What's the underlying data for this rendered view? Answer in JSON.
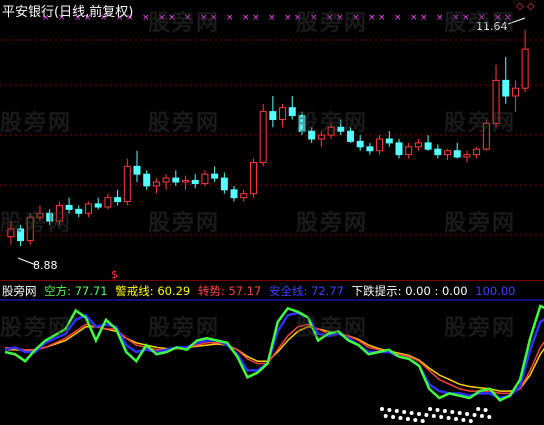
{
  "chart": {
    "title": "平安银行(日线,前复权)",
    "price_high_label": "11.64",
    "price_low_label": "8.88",
    "high_marker": "◇ ◇",
    "watermark": "股旁网",
    "colors": {
      "background": "#000000",
      "up_candle": "#ff3b3b",
      "down_candle": "#54ffff",
      "grid": "#8b0000",
      "x_marks": "#ff40ff"
    }
  },
  "indicator": {
    "name": "股旁网",
    "kongfang": {
      "label": "空方:",
      "value": "77.71",
      "color": "#54ff54"
    },
    "jingjie": {
      "label": "警戒线:",
      "value": "60.29",
      "color": "#ffff00"
    },
    "zhuanshi": {
      "label": "转势:",
      "value": "57.17",
      "color": "#ff4040"
    },
    "anquan": {
      "label": "安全线:",
      "value": "72.77",
      "color": "#4040ff"
    },
    "xiadie": {
      "label": "下跌提示:",
      "value": "0.00 : 0.00",
      "color": "#ffffff"
    },
    "last_value": {
      "value": "100.00",
      "color": "#4040ff"
    },
    "signal_icon": "$"
  },
  "chart_data": {
    "type": "candlestick",
    "price_range": [
      8.88,
      11.64
    ],
    "candles": [
      [
        9.0,
        9.2,
        8.9,
        9.1
      ],
      [
        9.1,
        9.15,
        8.88,
        8.95
      ],
      [
        8.95,
        9.3,
        8.9,
        9.25
      ],
      [
        9.25,
        9.4,
        9.2,
        9.3
      ],
      [
        9.3,
        9.35,
        9.15,
        9.2
      ],
      [
        9.2,
        9.45,
        9.15,
        9.4
      ],
      [
        9.4,
        9.5,
        9.3,
        9.35
      ],
      [
        9.35,
        9.4,
        9.25,
        9.3
      ],
      [
        9.3,
        9.45,
        9.25,
        9.42
      ],
      [
        9.42,
        9.5,
        9.35,
        9.38
      ],
      [
        9.38,
        9.55,
        9.35,
        9.5
      ],
      [
        9.5,
        9.6,
        9.4,
        9.45
      ],
      [
        9.45,
        10.0,
        9.4,
        9.9
      ],
      [
        9.9,
        10.1,
        9.7,
        9.8
      ],
      [
        9.8,
        9.85,
        9.6,
        9.65
      ],
      [
        9.65,
        9.75,
        9.55,
        9.7
      ],
      [
        9.7,
        9.8,
        9.6,
        9.75
      ],
      [
        9.75,
        9.85,
        9.65,
        9.7
      ],
      [
        9.7,
        9.78,
        9.6,
        9.72
      ],
      [
        9.72,
        9.8,
        9.62,
        9.68
      ],
      [
        9.68,
        9.85,
        9.65,
        9.8
      ],
      [
        9.8,
        9.9,
        9.7,
        9.75
      ],
      [
        9.75,
        9.82,
        9.55,
        9.6
      ],
      [
        9.6,
        9.65,
        9.45,
        9.5
      ],
      [
        9.5,
        9.6,
        9.45,
        9.55
      ],
      [
        9.55,
        10.0,
        9.5,
        9.95
      ],
      [
        9.95,
        10.7,
        9.9,
        10.6
      ],
      [
        10.6,
        10.8,
        10.4,
        10.5
      ],
      [
        10.5,
        10.7,
        10.4,
        10.65
      ],
      [
        10.65,
        10.8,
        10.5,
        10.55
      ],
      [
        10.55,
        10.6,
        10.3,
        10.35
      ],
      [
        10.35,
        10.4,
        10.2,
        10.25
      ],
      [
        10.25,
        10.35,
        10.15,
        10.3
      ],
      [
        10.3,
        10.45,
        10.25,
        10.4
      ],
      [
        10.4,
        10.5,
        10.3,
        10.35
      ],
      [
        10.35,
        10.4,
        10.2,
        10.22
      ],
      [
        10.22,
        10.3,
        10.1,
        10.15
      ],
      [
        10.15,
        10.2,
        10.05,
        10.1
      ],
      [
        10.1,
        10.3,
        10.05,
        10.25
      ],
      [
        10.25,
        10.35,
        10.15,
        10.2
      ],
      [
        10.2,
        10.25,
        10.0,
        10.05
      ],
      [
        10.05,
        10.2,
        10.0,
        10.15
      ],
      [
        10.15,
        10.25,
        10.1,
        10.2
      ],
      [
        10.2,
        10.3,
        10.1,
        10.12
      ],
      [
        10.12,
        10.18,
        10.0,
        10.05
      ],
      [
        10.05,
        10.12,
        9.98,
        10.1
      ],
      [
        10.1,
        10.2,
        10.0,
        10.02
      ],
      [
        10.02,
        10.1,
        9.95,
        10.05
      ],
      [
        10.05,
        10.15,
        10.0,
        10.12
      ],
      [
        10.12,
        10.5,
        10.1,
        10.45
      ],
      [
        10.45,
        11.2,
        10.4,
        11.0
      ],
      [
        11.0,
        11.3,
        10.7,
        10.8
      ],
      [
        10.8,
        11.0,
        10.6,
        10.9
      ],
      [
        10.9,
        11.64,
        10.85,
        11.4
      ]
    ]
  }
}
